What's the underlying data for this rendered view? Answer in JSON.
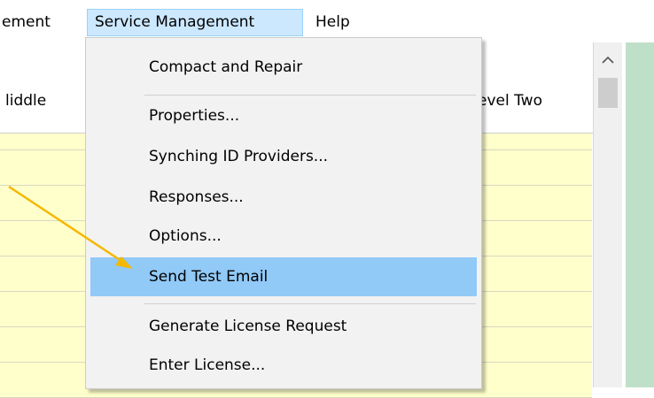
{
  "menubar": {
    "items": [
      {
        "label": "ement"
      },
      {
        "label": "Service Management"
      },
      {
        "label": "Help"
      }
    ]
  },
  "grid": {
    "headers": [
      "liddle",
      "evel Two"
    ],
    "selected_row_index": 0
  },
  "dropdown": {
    "items": [
      {
        "label": "Compact and Repair"
      },
      {
        "label": "Properties..."
      },
      {
        "label": "Synching ID Providers..."
      },
      {
        "label": "Responses..."
      },
      {
        "label": "Options..."
      },
      {
        "label": "Send Test Email"
      },
      {
        "label": "Generate License Request"
      },
      {
        "label": "Enter License..."
      }
    ],
    "highlighted_item": "Send Test Email"
  },
  "annotation": {
    "arrow_color": "#f5b800"
  },
  "colors": {
    "workspace_bg": "#bfe0c8",
    "row_bg": "#ffffcc",
    "selected_row": "#3399ff",
    "menu_highlight": "#91c9f7"
  },
  "icons": {
    "scroll_up": "chevron-up-icon"
  }
}
